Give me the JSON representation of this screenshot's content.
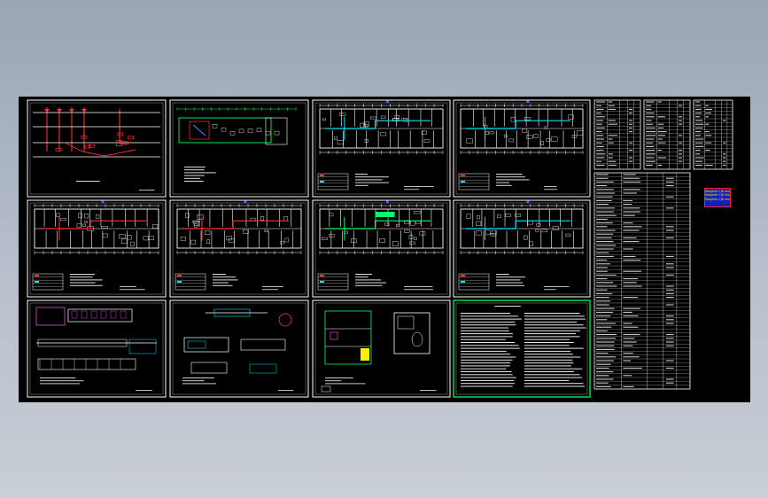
{
  "viewer": {
    "background_top": "#9aa5b5",
    "background_bottom": "#c9ced6",
    "canvas_color": "#000000"
  },
  "sheet_grid": {
    "rows": 3,
    "columns": 4,
    "frame_color": "#ffffff",
    "active_frame_color": "#00cc44",
    "active_sheet_index": 11
  },
  "sheets": [
    {
      "kind": "riser",
      "accent": "#ff3030"
    },
    {
      "kind": "site-plan",
      "accent": "#00ff66"
    },
    {
      "kind": "floor-plan",
      "accent": "#00e5ff"
    },
    {
      "kind": "floor-plan",
      "accent": "#00e5ff"
    },
    {
      "kind": "floor-plan",
      "accent": "#ff3030"
    },
    {
      "kind": "floor-plan",
      "accent": "#ff3030"
    },
    {
      "kind": "floor-plan",
      "accent": "#00ff66"
    },
    {
      "kind": "floor-plan",
      "accent": "#00e5ff"
    },
    {
      "kind": "detail",
      "accent": "#ff55ff"
    },
    {
      "kind": "detail",
      "accent": "#00e5ff"
    },
    {
      "kind": "detail",
      "accent": "#ffee00"
    },
    {
      "kind": "notes",
      "accent": "#ffffff"
    }
  ],
  "schedule_tables": {
    "count": 4,
    "color": "#ffffff"
  },
  "stamp": {
    "lines": [
      "Illegible CJK text line 1",
      "Illegible CJK text line 2",
      "Illegible CJK text line 3"
    ],
    "fill": "#1020c0",
    "border": "#ff2020",
    "text_color": "#ffe000"
  }
}
